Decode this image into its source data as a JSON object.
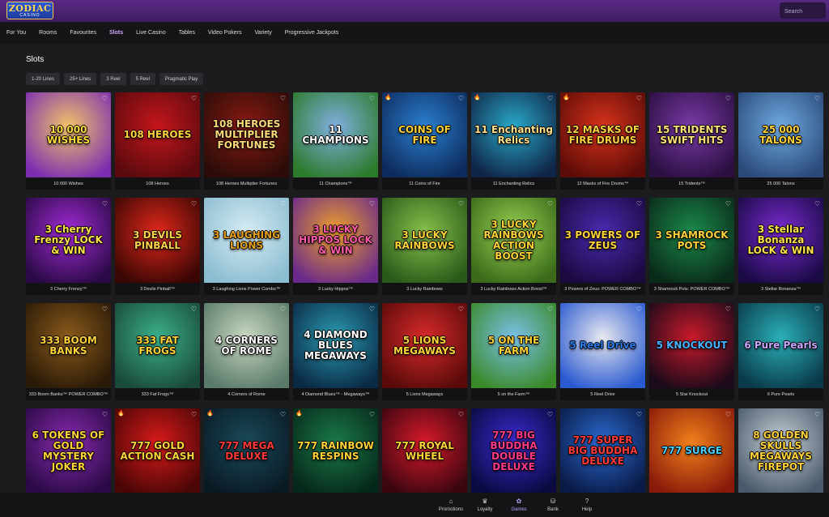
{
  "brand": {
    "logo_line1": "ZODIAC",
    "logo_line2": "CASINO"
  },
  "search": {
    "placeholder": "Search"
  },
  "nav": {
    "tabs": [
      {
        "label": "For You"
      },
      {
        "label": "Rooms"
      },
      {
        "label": "Favourites"
      },
      {
        "label": "Slots",
        "active": true
      },
      {
        "label": "Live Casino"
      },
      {
        "label": "Tables"
      },
      {
        "label": "Video Pokers"
      },
      {
        "label": "Variety"
      },
      {
        "label": "Progressive Jackpots"
      }
    ]
  },
  "section": {
    "title": "Slots"
  },
  "filters": [
    {
      "label": "1-20 Lines"
    },
    {
      "label": "25+ Lines"
    },
    {
      "label": "3 Reel"
    },
    {
      "label": "5 Reel"
    },
    {
      "label": "Pragmatic Play"
    }
  ],
  "games": [
    {
      "name": "10 000 Wishes",
      "art": "10 000 WISHES",
      "color1": "#f2c36a",
      "color2": "#7b2fb0",
      "text": "#ffdb3c"
    },
    {
      "name": "108 Heroes",
      "art": "108 HEROES",
      "color1": "#c4161c",
      "color2": "#5a0a0e",
      "text": "#ffcf3d"
    },
    {
      "name": "108 Heroes Multiplier Fortunes",
      "art": "108 HEROES MULTIPLIER FORTUNES",
      "color1": "#8a1a12",
      "color2": "#2b0c08",
      "text": "#ffd87a"
    },
    {
      "name": "11 Champions™",
      "art": "11 CHAMPIONS",
      "color1": "#7fb0e0",
      "color2": "#2c7a2c",
      "text": "#ffffff"
    },
    {
      "name": "11 Coins of Fire",
      "art": "COINS OF FIRE",
      "color1": "#2a7fd0",
      "color2": "#0d2b5c",
      "text": "#ffd23a",
      "hot": true
    },
    {
      "name": "11 Enchanting Relics",
      "art": "11 Enchanting Relics",
      "color1": "#2aa9c9",
      "color2": "#0f2446",
      "text": "#ffe08a",
      "hot": true
    },
    {
      "name": "12 Masks of Fire Drums™",
      "art": "12 MASKS OF FIRE DRUMS",
      "color1": "#d8321a",
      "color2": "#5c0c08",
      "text": "#ffcf40",
      "hot": true
    },
    {
      "name": "15 Tridents™",
      "art": "15 TRIDENTS SWIFT HITS",
      "color1": "#7a3aa8",
      "color2": "#2a0f40",
      "text": "#ffe27a"
    },
    {
      "name": "25 000 Talons",
      "art": "25 000 TALONS",
      "color1": "#6ea9e0",
      "color2": "#2a4a7a",
      "text": "#ffd23a"
    },
    {
      "name": "3 Cherry Frenzy™",
      "art": "3 Cherry Frenzy LOCK & WIN",
      "color1": "#a32ad6",
      "color2": "#2a0a46",
      "text": "#ffe14a"
    },
    {
      "name": "3 Devils Pinball™",
      "art": "3 DEVILS PINBALL",
      "color1": "#e0281a",
      "color2": "#3a0604",
      "text": "#ffd14a"
    },
    {
      "name": "3 Laughing Lions Power Combo™",
      "art": "3 LAUGHING LIONS",
      "color1": "#d7ecf5",
      "color2": "#8bbdd0",
      "text": "#e8a01c"
    },
    {
      "name": "3 Lucky Hippos™",
      "art": "3 LUCKY HIPPOS LOCK & WIN",
      "color1": "#f0a12a",
      "color2": "#6a2a8a",
      "text": "#ff5aa8"
    },
    {
      "name": "3 Lucky Rainbows",
      "art": "3 LUCKY RAINBOWS",
      "color1": "#88c04a",
      "color2": "#2a5a1a",
      "text": "#ffd23a"
    },
    {
      "name": "3 Lucky Rainbows Action Boost™",
      "art": "3 LUCKY RAINBOWS ACTION BOOST",
      "color1": "#98d050",
      "color2": "#3a6a1a",
      "text": "#ffd23a"
    },
    {
      "name": "3 Powers of Zeus: POWER COMBO™",
      "art": "3 POWERS OF ZEUS",
      "color1": "#4a2ab0",
      "color2": "#1a0a40",
      "text": "#ffd23a"
    },
    {
      "name": "3 Shamrock Pots: POWER COMBO™",
      "art": "3 SHAMROCK POTS",
      "color1": "#1a8a4a",
      "color2": "#0a2a1a",
      "text": "#ffd23a"
    },
    {
      "name": "3 Stellar Bonanza™",
      "art": "3 Stellar Bonanza LOCK & WIN",
      "color1": "#7a2ad0",
      "color2": "#1a0a46",
      "text": "#ffe14a"
    },
    {
      "name": "333 Boom Banks™ POWER COMBO™",
      "art": "333 BOOM BANKS",
      "color1": "#8a5a1a",
      "color2": "#2a1a08",
      "text": "#ffd23a"
    },
    {
      "name": "333 Fat Frogs™",
      "art": "333 FAT FROGS",
      "color1": "#3ab08a",
      "color2": "#1a4a3a",
      "text": "#ffd23a"
    },
    {
      "name": "4 Corners of Rome",
      "art": "4 CORNERS OF ROME",
      "color1": "#c8d8c0",
      "color2": "#5a7a6a",
      "text": "#ffffff"
    },
    {
      "name": "4 Diamond Blues™ - Megaways™",
      "art": "4 DIAMOND BLUES MEGAWAYS",
      "color1": "#2a9ab0",
      "color2": "#0a2a46",
      "text": "#ffffff"
    },
    {
      "name": "5 Lions Megaways",
      "art": "5 LIONS MEGAWAYS",
      "color1": "#d82a2a",
      "color2": "#5a0a0a",
      "text": "#ffd23a"
    },
    {
      "name": "5 on the Farm™",
      "art": "5 ON THE FARM",
      "color1": "#7ac0e8",
      "color2": "#3a8a2a",
      "text": "#ffd23a"
    },
    {
      "name": "5 Reel Drive",
      "art": "5 Reel Drive",
      "color1": "#e8e8f0",
      "color2": "#2a5ad0",
      "text": "#2a7ae8"
    },
    {
      "name": "5 Star Knockout",
      "art": "5 KNOCKOUT",
      "color1": "#c81a2a",
      "color2": "#1a0a1a",
      "text": "#4ab0ff"
    },
    {
      "name": "6 Pure Pearls",
      "art": "6 Pure Pearls",
      "color1": "#2ab0b8",
      "color2": "#0a3a4a",
      "text": "#c8a8ff"
    },
    {
      "name": "",
      "art": "6 TOKENS OF GOLD MYSTERY JOKER",
      "color1": "#8a2ab0",
      "color2": "#2a0a46",
      "text": "#ffd23a"
    },
    {
      "name": "",
      "art": "777 GOLD ACTION CASH",
      "color1": "#d81a1a",
      "color2": "#4a0606",
      "text": "#ffd23a",
      "hot": true
    },
    {
      "name": "",
      "art": "777 MEGA DELUXE",
      "color1": "#1a4a5a",
      "color2": "#0a1a24",
      "text": "#ff3a3a",
      "hot": true
    },
    {
      "name": "",
      "art": "777 RAINBOW RESPINS",
      "color1": "#1a7a4a",
      "color2": "#06281a",
      "text": "#ffd23a",
      "hot": true
    },
    {
      "name": "",
      "art": "777 ROYAL WHEEL",
      "color1": "#d81a2a",
      "color2": "#3a0610",
      "text": "#ffd23a"
    },
    {
      "name": "",
      "art": "777 BIG BUDDHA DOUBLE DELUXE",
      "color1": "#3a2ad0",
      "color2": "#0a0a40",
      "text": "#ff3a8a"
    },
    {
      "name": "",
      "art": "777 SUPER BIG BUDDHA DELUXE",
      "color1": "#2a6ad0",
      "color2": "#0a1a46",
      "text": "#ff3a3a"
    },
    {
      "name": "",
      "art": "777 SURGE",
      "color1": "#f0801a",
      "color2": "#8a1a0a",
      "text": "#4ad0ff"
    },
    {
      "name": "",
      "art": "8 GOLDEN SKULLS MEGAWAYS FIREPOT",
      "color1": "#c8d0d8",
      "color2": "#4a5a6a",
      "text": "#ffd23a"
    }
  ],
  "bottom_nav": [
    {
      "label": "Promotions",
      "icon": "⌂"
    },
    {
      "label": "Loyalty",
      "icon": "♛"
    },
    {
      "label": "Games",
      "icon": "✿",
      "active": true
    },
    {
      "label": "Bank",
      "icon": "⛁"
    },
    {
      "label": "Help",
      "icon": "?"
    }
  ]
}
